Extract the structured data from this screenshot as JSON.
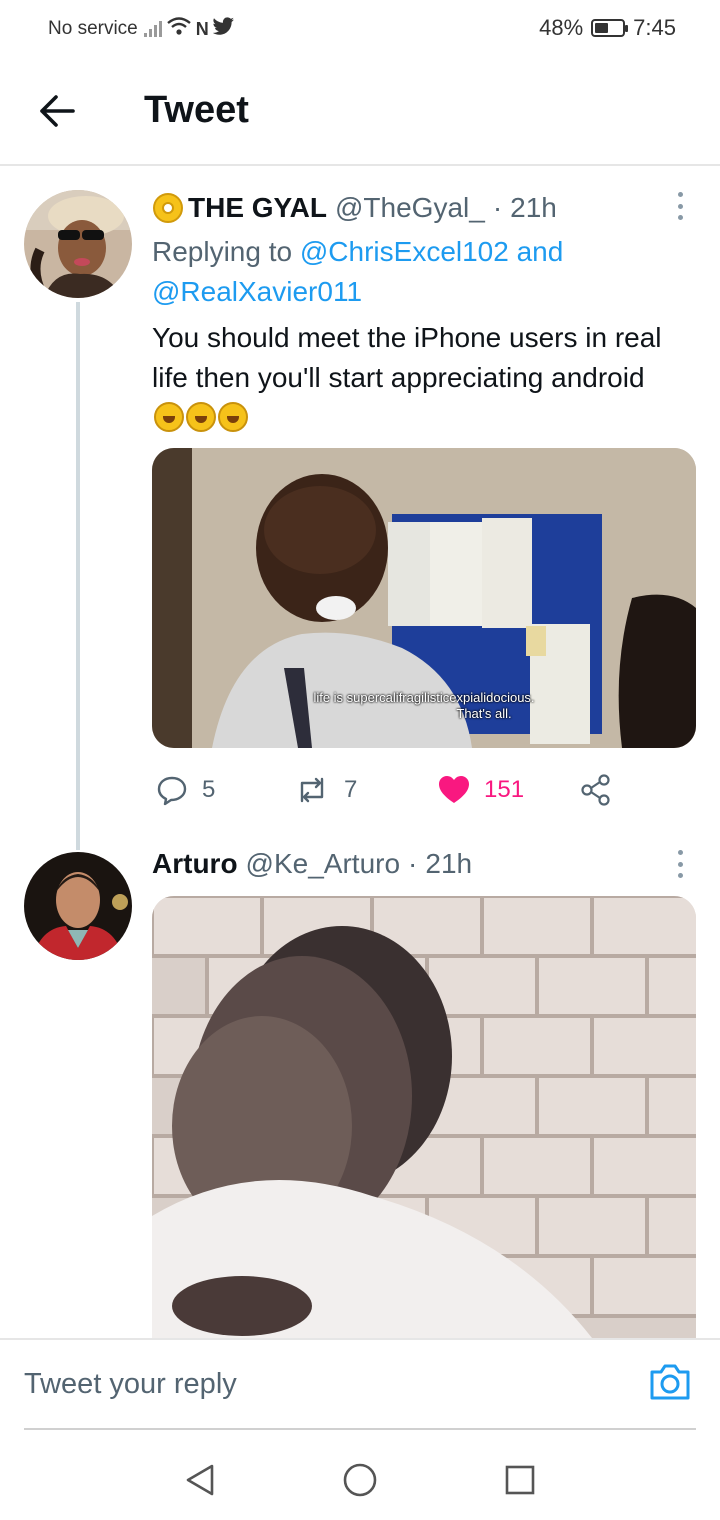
{
  "status_bar": {
    "carrier": "No service",
    "battery": "48%",
    "battery_level": 0.48,
    "time": "7:45",
    "icons": [
      "no-signal-icon",
      "wifi-icon",
      "nfc-icon",
      "twitter-bird-icon",
      "battery-icon"
    ]
  },
  "header": {
    "title": "Tweet",
    "back_icon": "arrow-left-icon"
  },
  "tweets": [
    {
      "name": "THE GYAL",
      "name_prefix_icon": "dvd-disc-icon",
      "handle": "@TheGyal_",
      "separator": "·",
      "time": "21h",
      "replying_prefix": "Replying to",
      "replying_mention_1": "@ChrisExcel102",
      "replying_and": "and",
      "replying_mention_2": "@RealXavier011",
      "text": "You should meet the iPhone users in real life then you'll start appreciating android",
      "text_emoji": [
        "rolling-laughing-emoji",
        "rolling-laughing-emoji",
        "rolling-laughing-emoji"
      ],
      "media_caption_1": "life is supercalifragilisticexpialidocious.",
      "media_caption_2": "That's all.",
      "replies": "5",
      "retweets": "7",
      "likes": "151",
      "liked": true
    },
    {
      "name": "Arturo",
      "handle": "@Ke_Arturo",
      "separator": "·",
      "time": "21h"
    }
  ],
  "reply_bar": {
    "placeholder": "Tweet your reply",
    "camera_icon": "camera-icon"
  },
  "nav_bar": {
    "icons": [
      "back-triangle-icon",
      "home-circle-icon",
      "recents-square-icon"
    ]
  },
  "colors": {
    "accent": "#1d9bf0",
    "like": "#f91880",
    "text": "#0f1419",
    "secondary": "#536471"
  }
}
